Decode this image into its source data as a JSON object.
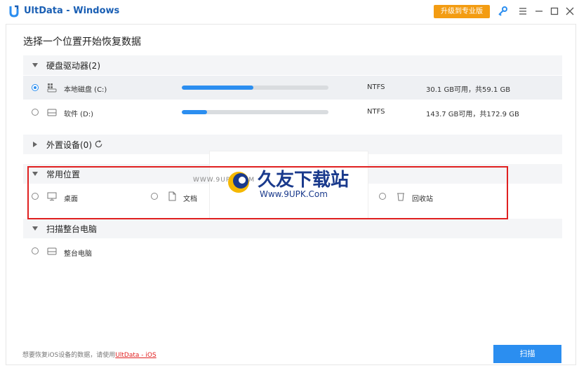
{
  "window": {
    "title": "UltData - Windows",
    "upgrade_label": "升级到专业版"
  },
  "main": {
    "heading": "选择一个位置开始恢复数据"
  },
  "hard_drives": {
    "header": "硬盘驱动器(2)",
    "drives": [
      {
        "name": "本地磁盘 (C:)",
        "fs": "NTFS",
        "usage_text": "30.1 GB可用，共59.1 GB",
        "used_fraction": 0.49,
        "selected": true
      },
      {
        "name": "软件 (D:)",
        "fs": "NTFS",
        "usage_text": "143.7 GB可用，共172.9 GB",
        "used_fraction": 0.17,
        "selected": false
      }
    ]
  },
  "external": {
    "header": "外置设备(0)"
  },
  "common": {
    "header": "常用位置",
    "items": [
      {
        "label": "桌面"
      },
      {
        "label": "文档"
      },
      {
        "label": "回收站"
      }
    ]
  },
  "scan_all": {
    "header": "扫描整台电脑",
    "item": "整台电脑"
  },
  "watermark": {
    "small": "WWW.9UPK.COM",
    "title": "久友下载站",
    "url": "Www.9UPK.Com"
  },
  "footer": {
    "text": "想要恢复iOS设备的数据，请使用",
    "link": "UltData - iOS",
    "scan_label": "扫描"
  },
  "colors": {
    "accent": "#2b8ef0",
    "upgrade": "#f39c12",
    "highlight_border": "#e02020"
  }
}
